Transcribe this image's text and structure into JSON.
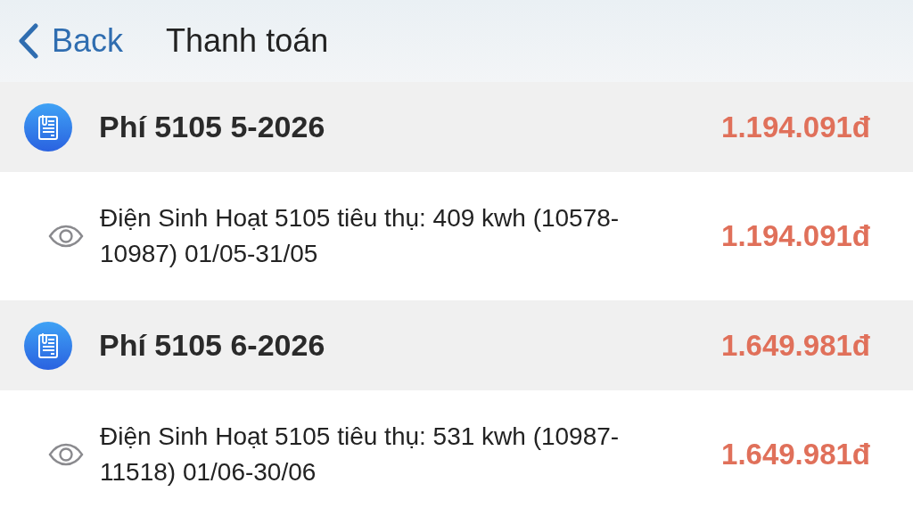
{
  "nav": {
    "back": "Back",
    "title": "Thanh toán"
  },
  "groups": [
    {
      "title": "Phí 5105 5-2026",
      "amount": "1.194.091đ",
      "items": [
        {
          "description": "Điện Sinh Hoạt 5105 tiêu thụ: 409 kwh (10578-10987) 01/05-31/05",
          "amount": "1.194.091đ"
        }
      ]
    },
    {
      "title": "Phí 5105 6-2026",
      "amount": "1.649.981đ",
      "items": [
        {
          "description": "Điện Sinh Hoạt 5105 tiêu thụ: 531 kwh (10987-11518) 01/06-30/06",
          "amount": "1.649.981đ"
        }
      ]
    }
  ]
}
